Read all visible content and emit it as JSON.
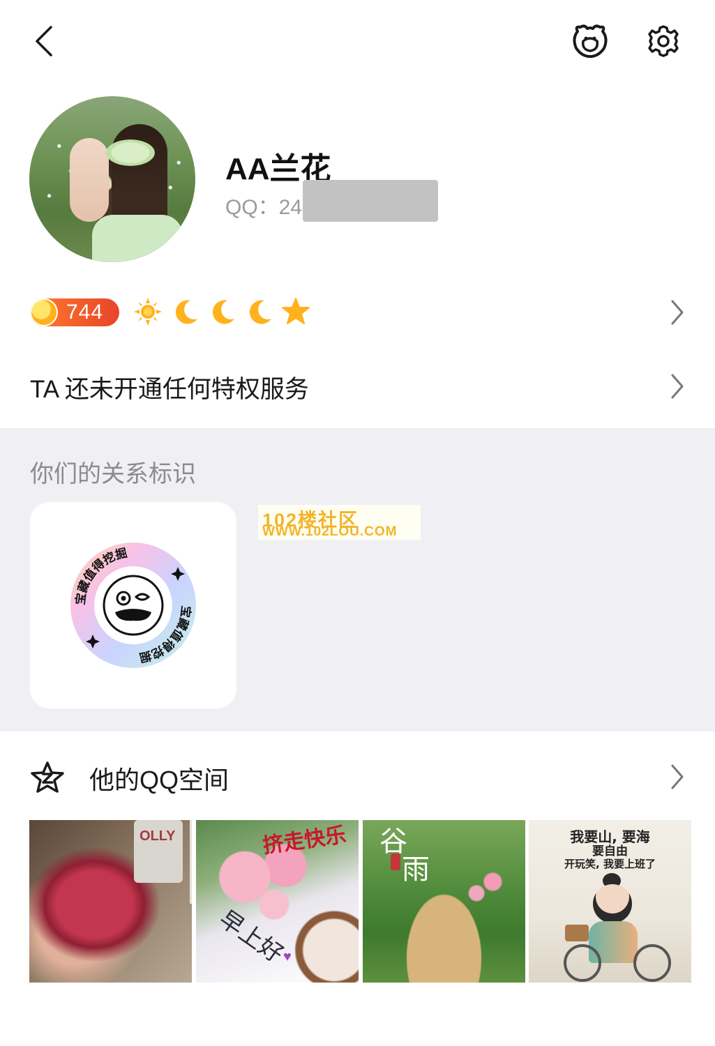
{
  "profile": {
    "nickname": "AA兰花",
    "qq_label": "QQ：24"
  },
  "level": {
    "value": "744",
    "icons": [
      "sun-icon",
      "moon-icon",
      "moon-icon",
      "moon-icon",
      "star-icon"
    ]
  },
  "privilege": {
    "text": "TA 还未开通任何特权服务"
  },
  "relation": {
    "title": "你们的关系标识",
    "badge_text": "宝藏值得挖掘"
  },
  "watermark": {
    "line1": "102楼社区",
    "line2": "WWW.102LOU.COM"
  },
  "zone": {
    "label": "他的QQ空间",
    "photos": [
      {
        "caption": "OLLY"
      },
      {
        "caption_top": "挤走快乐",
        "caption_bottom": "早上好"
      },
      {
        "caption_top": "谷",
        "caption_bottom": "雨"
      },
      {
        "line1": "我要山, 要海",
        "line2": "要自由",
        "line3": "开玩笑, 我要上班了"
      }
    ]
  },
  "colors": {
    "accent_orange": "#ff7b2e",
    "level_gold": "#ffb21c",
    "section_gray": "#f0f0f4"
  }
}
